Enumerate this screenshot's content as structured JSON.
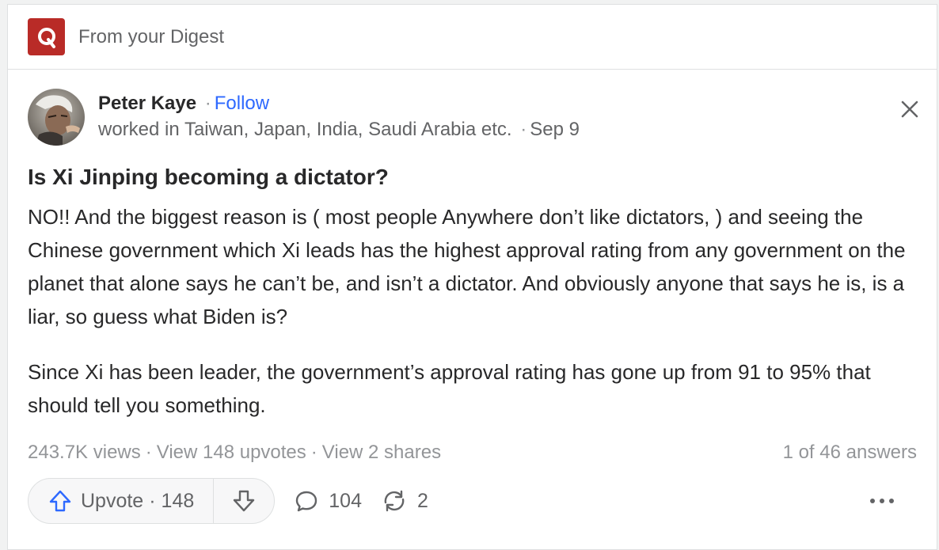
{
  "digest": {
    "title": "From your Digest",
    "logo_icon": "quora-logo-icon",
    "brand_color": "#b92b27"
  },
  "author": {
    "name": "Peter Kaye",
    "separator": "·",
    "follow_label": "Follow",
    "credential": "worked in Taiwan, Japan, India, Saudi Arabia etc.",
    "date": "Sep 9"
  },
  "question": "Is Xi Jinping becoming a dictator?",
  "answer": {
    "paragraphs": [
      "NO!! And the biggest reason is ( most people Anywhere don’t like dictators, ) and seeing the Chinese government which Xi leads has the highest approval rating from any government on the planet that alone says he can’t be, and isn’t a dictator. And obviously anyone that says he is, is a liar, so guess what Biden is?",
      "Since Xi has been leader, the government’s approval rating has gone up from 91 to 95% that should tell you something."
    ]
  },
  "stats": {
    "views": "243.7K views",
    "upvotes": "View 148 upvotes",
    "shares": "View 2 shares",
    "position": "1 of 46 answers",
    "separator": "·"
  },
  "actions": {
    "upvote_label": "Upvote",
    "upvote_count": "148",
    "comment_count": "104",
    "share_count": "2"
  },
  "icons": {
    "close": "close-icon",
    "upvote": "upvote-arrow-icon",
    "downvote": "downvote-arrow-icon",
    "comment": "comment-icon",
    "share": "share-icon",
    "more": "more-icon"
  },
  "colors": {
    "link": "#2e69ff",
    "text": "#282829",
    "muted": "#939598",
    "upvote_blue": "#2e69ff"
  }
}
